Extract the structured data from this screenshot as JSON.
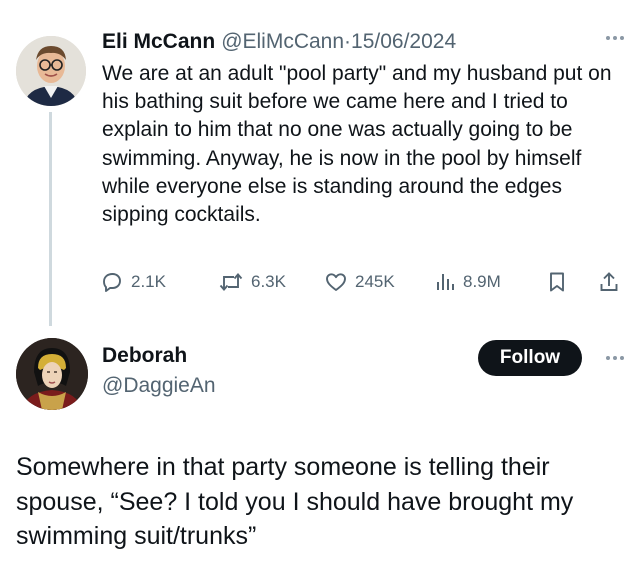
{
  "tweet1": {
    "author_name": "Eli McCann",
    "author_handle": "@EliMcCann",
    "date": "·15/06/2024",
    "text": "We are at an adult \"pool party\" and my husband put on his bathing suit before we came here and I tried to explain to him that no one was actually going to be swimming. Anyway, he is now in the pool by himself while everyone else is standing around the edges sipping cocktails.",
    "stats": {
      "replies": "2.1K",
      "reposts": "6.3K",
      "likes": "245K",
      "views": "8.9M"
    },
    "icons": {
      "reply": "reply-icon",
      "repost": "repost-icon",
      "like": "heart-icon",
      "views": "views-icon",
      "bookmark": "bookmark-icon",
      "share": "share-icon",
      "more": "more-icon"
    }
  },
  "tweet2": {
    "author_name": "Deborah",
    "author_handle": "@DaggieAn",
    "follow_label": "Follow",
    "text": "Somewhere in that party someone is telling their spouse, “See? I told you I should have brought my swimming suit/trunks”"
  },
  "colors": {
    "text": "#0f1419",
    "secondary": "#536471",
    "follow_button": "#0f1419",
    "thread_line": "#cfd9de"
  }
}
